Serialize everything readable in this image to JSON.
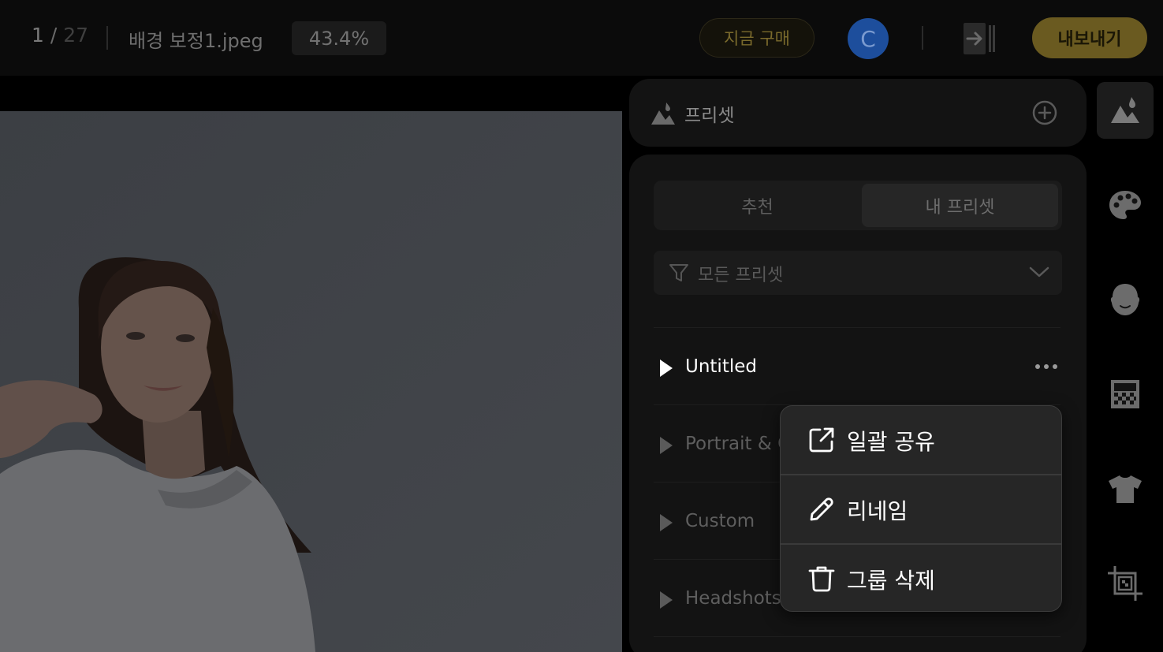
{
  "topbar": {
    "current_page": "1",
    "page_sep": " / ",
    "total_pages": "27",
    "filename": "배경 보정1.jpeg",
    "zoom": "43.4%",
    "buy_now": "지금 구매",
    "avatar_letter": "C",
    "export": "내보내기"
  },
  "panel": {
    "title": "프리셋",
    "tabs": [
      {
        "label": "추천",
        "selected": false
      },
      {
        "label": "내 프리셋",
        "selected": true
      }
    ],
    "filter": {
      "value": "모든 프리셋"
    },
    "groups": [
      {
        "name": "Untitled"
      },
      {
        "name": "Portrait & C"
      },
      {
        "name": "Custom"
      },
      {
        "name": "Headshots"
      }
    ]
  },
  "context_menu": {
    "items": [
      {
        "label": "일괄 공유",
        "icon": "share-icon"
      },
      {
        "label": "리네임",
        "icon": "pencil-icon"
      },
      {
        "label": "그룹 삭제",
        "icon": "trash-icon"
      }
    ]
  },
  "toolbar": {
    "items": [
      "preset-icon",
      "palette-icon",
      "face-icon",
      "background-icon",
      "clothing-icon",
      "crop-icon"
    ]
  }
}
